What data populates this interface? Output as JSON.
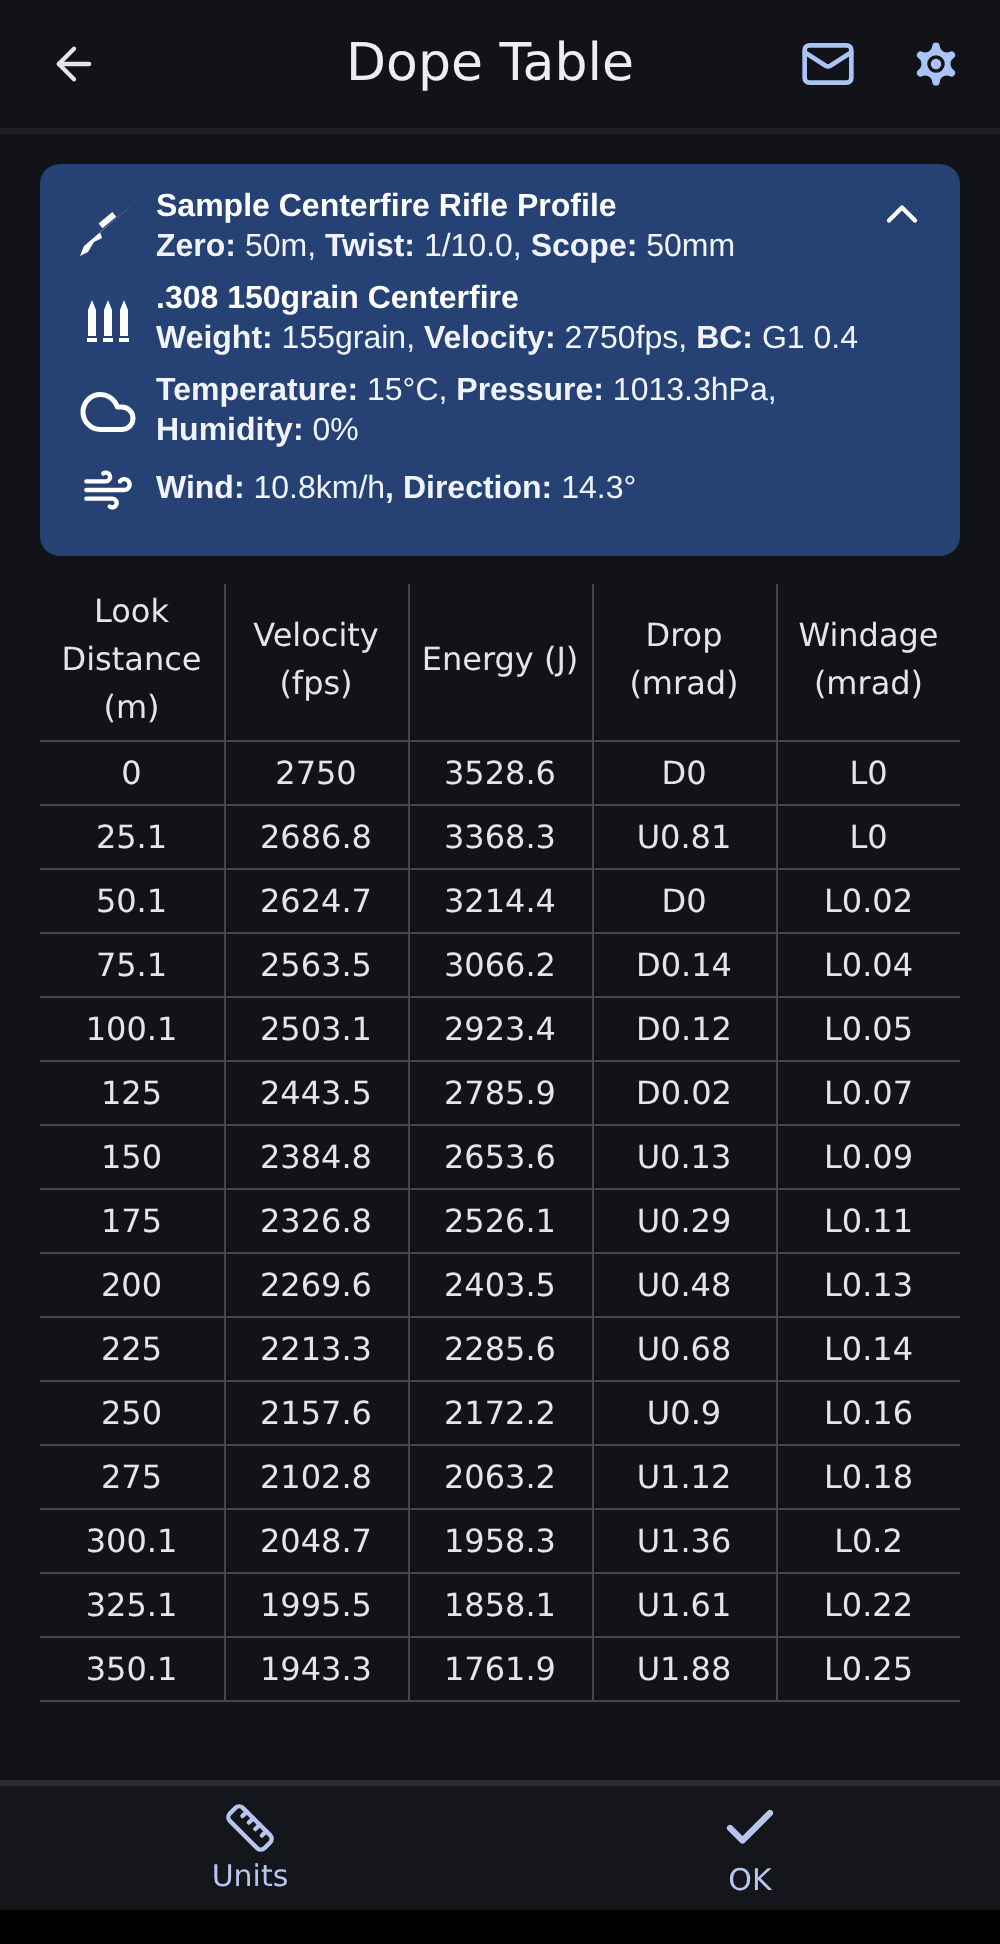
{
  "app_bar": {
    "title": "Dope Table"
  },
  "profile_card": {
    "expanded": true,
    "sections": [
      {
        "kind": "rifle",
        "title": "Sample Centerfire Rifle Profile",
        "details": "**Zero:** 50m, **Twist:** 1/10.0, **Scope:** 50mm"
      },
      {
        "kind": "ammo",
        "title": ".308 150grain Centerfire",
        "details": "**Weight:** 155grain, **Velocity:** 2750fps, **BC:** G1 0.4"
      },
      {
        "kind": "weather",
        "details": "**Temperature:** 15°C, **Pressure:** 1013.3hPa, **Humidity:** 0%"
      },
      {
        "kind": "wind",
        "details": "**Wind:** 10.8km/h**,** **Direction:** 14.3°"
      }
    ]
  },
  "table": {
    "columns": [
      "Look Distance (m)",
      "Velocity (fps)",
      "Energy (J)",
      "Drop (mrad)",
      "Windage (mrad)"
    ],
    "rows": [
      [
        "0",
        "2750",
        "3528.6",
        "D0",
        "L0"
      ],
      [
        "25.1",
        "2686.8",
        "3368.3",
        "U0.81",
        "L0"
      ],
      [
        "50.1",
        "2624.7",
        "3214.4",
        "D0",
        "L0.02"
      ],
      [
        "75.1",
        "2563.5",
        "3066.2",
        "D0.14",
        "L0.04"
      ],
      [
        "100.1",
        "2503.1",
        "2923.4",
        "D0.12",
        "L0.05"
      ],
      [
        "125",
        "2443.5",
        "2785.9",
        "D0.02",
        "L0.07"
      ],
      [
        "150",
        "2384.8",
        "2653.6",
        "U0.13",
        "L0.09"
      ],
      [
        "175",
        "2326.8",
        "2526.1",
        "U0.29",
        "L0.11"
      ],
      [
        "200",
        "2269.6",
        "2403.5",
        "U0.48",
        "L0.13"
      ],
      [
        "225",
        "2213.3",
        "2285.6",
        "U0.68",
        "L0.14"
      ],
      [
        "250",
        "2157.6",
        "2172.2",
        "U0.9",
        "L0.16"
      ],
      [
        "275",
        "2102.8",
        "2063.2",
        "U1.12",
        "L0.18"
      ],
      [
        "300.1",
        "2048.7",
        "1958.3",
        "U1.36",
        "L0.2"
      ],
      [
        "325.1",
        "1995.5",
        "1858.1",
        "U1.61",
        "L0.22"
      ],
      [
        "350.1",
        "1943.3",
        "1761.9",
        "U1.88",
        "L0.25"
      ]
    ]
  },
  "bottom_nav": [
    {
      "kind": "units",
      "label": "Units"
    },
    {
      "kind": "ok",
      "label": "OK"
    }
  ]
}
